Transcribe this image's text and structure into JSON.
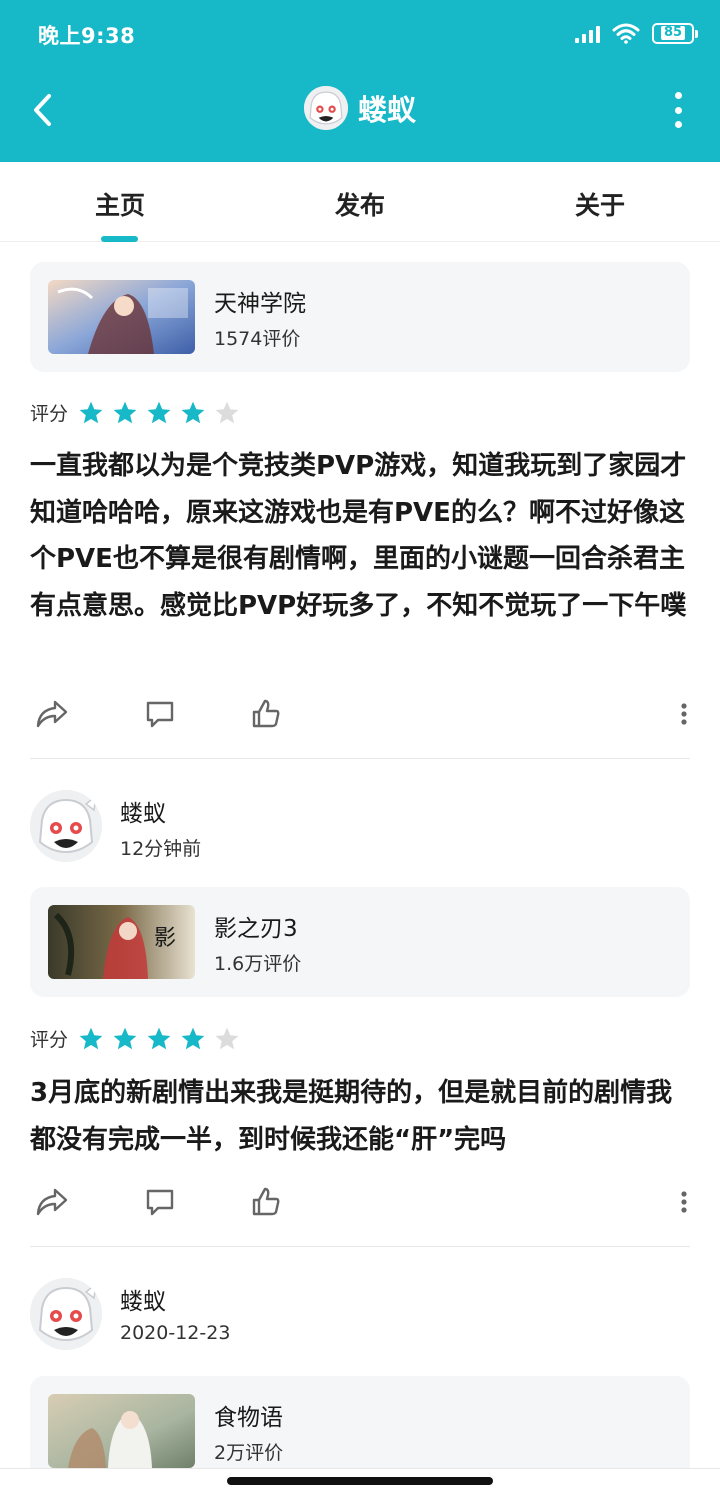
{
  "status_bar": {
    "time": "晚上9:38",
    "battery": "85"
  },
  "header": {
    "title": "蝼蚁"
  },
  "tabs": [
    {
      "label": "主页",
      "active": true
    },
    {
      "label": "发布",
      "active": false
    },
    {
      "label": "关于",
      "active": false
    }
  ],
  "colors": {
    "accent": "#17b8c8",
    "star_on": "#17b8c8",
    "star_off": "#dcdcdc"
  },
  "posts": [
    {
      "game": {
        "name": "天神学院",
        "count": "1574评价"
      },
      "rating_label": "评分",
      "rating": 4,
      "text": "一直我都以为是个竞技类PVP游戏，知道我玩到了家园才知道哈哈哈，原来这游戏也是有PVE的么？啊不过好像这个PVE也不算是很有剧情啊，里面的小谜题一回合杀君主有点意思。感觉比PVP好玩多了，不知不觉玩了一下午噗"
    },
    {
      "user": {
        "name": "蝼蚁",
        "time": "12分钟前"
      },
      "game": {
        "name": "影之刃3",
        "count": "1.6万评价"
      },
      "rating_label": "评分",
      "rating": 4,
      "text": "3月底的新剧情出来我是挺期待的，但是就目前的剧情我都没有完成一半，到时候我还能“肝”完吗"
    },
    {
      "user": {
        "name": "蝼蚁",
        "time": "2020-12-23"
      },
      "game": {
        "name": "食物语",
        "count": "2万评价"
      }
    }
  ],
  "icons": [
    "back-arrow-icon",
    "more-vertical-icon",
    "share-icon",
    "comment-icon",
    "like-icon",
    "star-icon"
  ]
}
